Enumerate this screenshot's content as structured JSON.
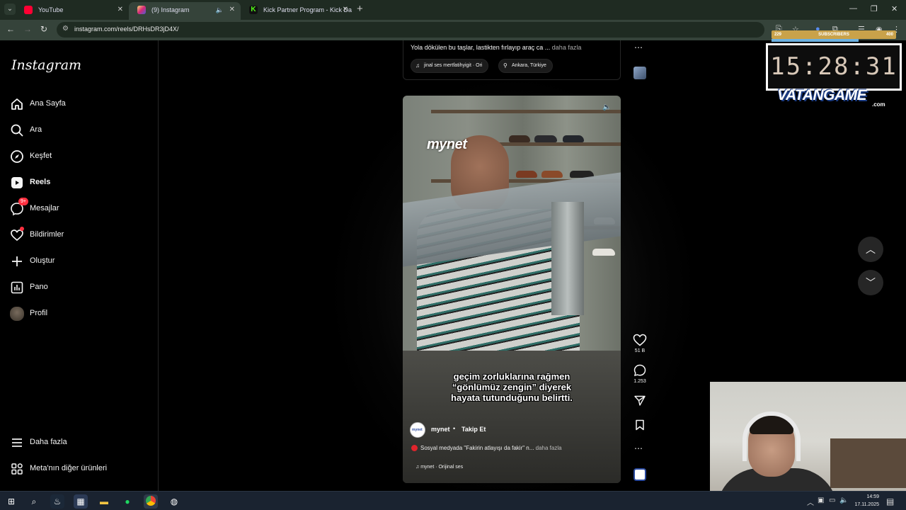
{
  "browser": {
    "tabs": [
      {
        "title": "YouTube",
        "favicon_color": "#ff0033"
      },
      {
        "title": "(9) Instagram",
        "favicon_color": "#d6249f",
        "active": true
      },
      {
        "title": "Kick Partner Program - Kick Da",
        "favicon_color": "#53fc18"
      }
    ],
    "url": "instagram.com/reels/DRHsDR3jD4X/"
  },
  "sidebar": {
    "logo": "Instagram",
    "items": [
      {
        "label": "Ana Sayfa",
        "icon": "home-icon"
      },
      {
        "label": "Ara",
        "icon": "search-icon"
      },
      {
        "label": "Keşfet",
        "icon": "compass-icon"
      },
      {
        "label": "Reels",
        "icon": "reels-icon",
        "active": true
      },
      {
        "label": "Mesajlar",
        "icon": "messenger-icon",
        "badge": "9+"
      },
      {
        "label": "Bildirimler",
        "icon": "heart-icon",
        "dot": true
      },
      {
        "label": "Oluştur",
        "icon": "plus-icon"
      },
      {
        "label": "Pano",
        "icon": "dashboard-icon"
      },
      {
        "label": "Profil",
        "icon": "avatar"
      }
    ],
    "bottom": [
      {
        "label": "Daha fazla",
        "icon": "menu-icon"
      },
      {
        "label": "Meta'nın diğer ürünleri",
        "icon": "apps-icon"
      }
    ]
  },
  "prev_post": {
    "caption": "Yola dökülen bu taşlar, lastikten fırlayıp araç ca ...",
    "more": "daha fazla",
    "audio_chip": "jinal ses   mertfatihyigit · Ori",
    "location_chip": "Ankara, Türkiye"
  },
  "reel": {
    "watermark": "mynet",
    "subtitle_lines": [
      "geçim zorluklarına rağmen",
      "“gönlümüz zengin” diyerek",
      "hayata tutunduğunu belirtti."
    ],
    "author": "mynet",
    "follow": "Takip Et",
    "caption": "Sosyal medyada \"Fakirin atlayışı da fakir\" n...",
    "more": "daha fazla",
    "audio": "mynet · Orijinal ses",
    "avatar_text": "mynet"
  },
  "actions": {
    "likes": "51 B",
    "comments": "1.253"
  },
  "overlay": {
    "subs_left": "229",
    "subs_label": "SUBSCRIBERS",
    "subs_right": "400",
    "subs_progress": 0.7,
    "clock": "15:28:31",
    "brand": "VATANGAME",
    "brand_suffix": ".com"
  },
  "taskbar": {
    "time": "14:59",
    "date": "17.11.2025"
  }
}
